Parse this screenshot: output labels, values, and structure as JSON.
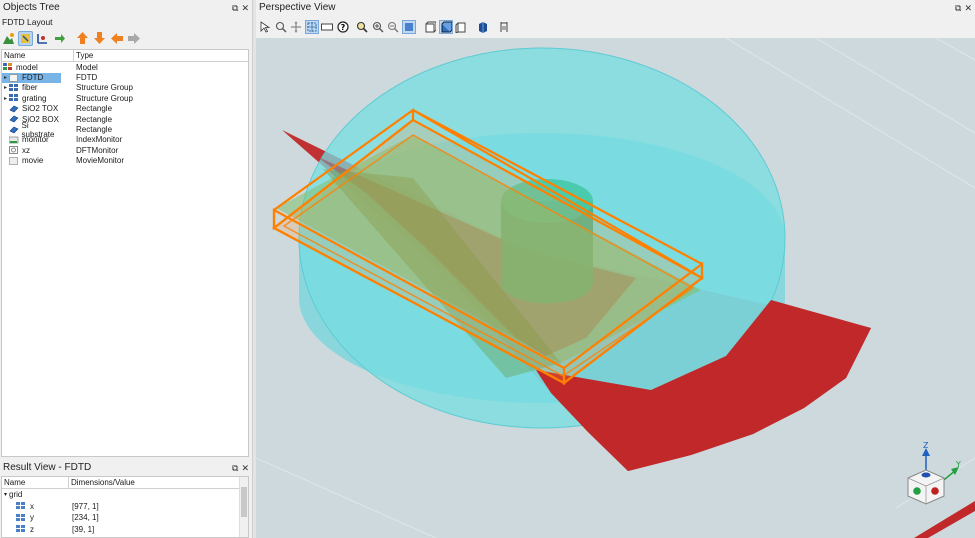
{
  "objects_tree": {
    "title": "Objects Tree",
    "subtitle": "FDTD Layout",
    "columns": [
      "Name",
      "Type"
    ],
    "rows": [
      {
        "name": "model",
        "type": "Model",
        "icon": "model-icon",
        "arrow": ""
      },
      {
        "name": "FDTD",
        "type": "FDTD",
        "icon": "fdtd-icon",
        "arrow": "▸",
        "selected": true
      },
      {
        "name": "fiber",
        "type": "Structure Group",
        "icon": "group-icon",
        "arrow": "▸"
      },
      {
        "name": "grating",
        "type": "Structure Group",
        "icon": "group-icon",
        "arrow": "▸"
      },
      {
        "name": "SiO2 TOX",
        "type": "Rectangle",
        "icon": "rectangle-icon",
        "arrow": ""
      },
      {
        "name": "SiO2 BOX",
        "type": "Rectangle",
        "icon": "rectangle-icon",
        "arrow": ""
      },
      {
        "name": "Si substrate",
        "type": "Rectangle",
        "icon": "rectangle-icon",
        "arrow": ""
      },
      {
        "name": "monitor",
        "type": "IndexMonitor",
        "icon": "index-monitor-icon",
        "arrow": ""
      },
      {
        "name": "xz",
        "type": "DFTMonitor",
        "icon": "dft-monitor-icon",
        "arrow": ""
      },
      {
        "name": "movie",
        "type": "MovieMonitor",
        "icon": "movie-monitor-icon",
        "arrow": ""
      }
    ]
  },
  "result_view": {
    "title": "Result View - FDTD",
    "columns": [
      "Name",
      "Dimensions/Value"
    ],
    "group": "grid",
    "rows": [
      {
        "name": "x",
        "value": "[977, 1]"
      },
      {
        "name": "y",
        "value": "[234, 1]"
      },
      {
        "name": "z",
        "value": "[39, 1]"
      }
    ]
  },
  "perspective_view": {
    "title": "Perspective View",
    "axes": {
      "z": "Z",
      "y": "Y"
    }
  },
  "colors": {
    "selection": "#78b4e6",
    "viewport_bg": "#cdd9dc",
    "cladding": "#6fd6dc",
    "monitor_plane": "#c0282a",
    "fdtd_region": "#ff8000"
  }
}
